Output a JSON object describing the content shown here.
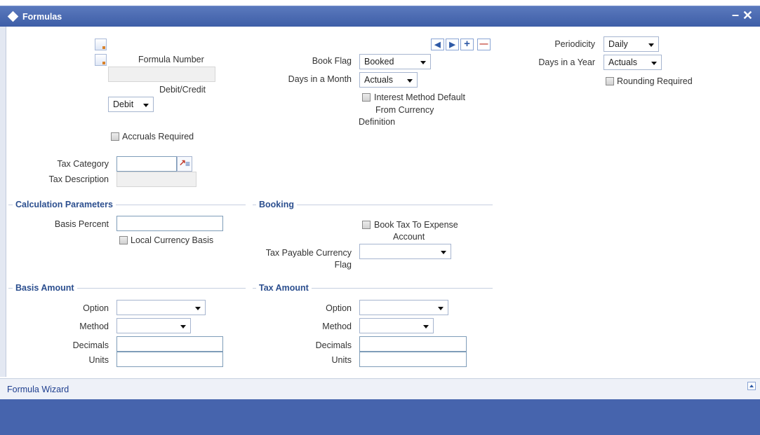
{
  "window": {
    "title": "Formulas",
    "minimize": "–",
    "close": "✕"
  },
  "toolbar": {
    "prev": "◀",
    "next": "▶",
    "add": "+",
    "delete": "—"
  },
  "main": {
    "formula_number_label": "Formula Number",
    "formula_number_value": "",
    "debit_credit_label": "Debit/Credit",
    "debit_credit_value": "Debit",
    "accruals_required_label": "Accruals Required",
    "tax_category_label": "Tax Category",
    "tax_category_value": "",
    "tax_description_label": "Tax Description",
    "tax_description_value": "",
    "book_flag_label": "Book Flag",
    "book_flag_value": "Booked",
    "days_in_month_label": "Days in a Month",
    "days_in_month_value": "Actuals",
    "interest_method_line1": "Interest Method Default",
    "interest_method_line2": "From Currency",
    "interest_method_line3": "Definition",
    "periodicity_label": "Periodicity",
    "periodicity_value": "Daily",
    "days_in_year_label": "Days in a Year",
    "days_in_year_value": "Actuals",
    "rounding_required_label": "Rounding Required"
  },
  "calculation": {
    "header": "Calculation Parameters",
    "basis_percent_label": "Basis Percent",
    "basis_percent_value": "",
    "local_currency_basis_label": "Local Currency Basis"
  },
  "booking": {
    "header": "Booking",
    "book_tax_line1": "Book Tax To Expense",
    "book_tax_line2": "Account",
    "tax_payable_line1": "Tax Payable Currency",
    "tax_payable_line2": "Flag",
    "tax_payable_value": ""
  },
  "basis_amount": {
    "header": "Basis Amount",
    "option_label": "Option",
    "option_value": "",
    "method_label": "Method",
    "method_value": "",
    "decimals_label": "Decimals",
    "decimals_value": "",
    "units_label": "Units",
    "units_value": ""
  },
  "tax_amount": {
    "header": "Tax Amount",
    "option_label": "Option",
    "option_value": "",
    "method_label": "Method",
    "method_value": "",
    "decimals_label": "Decimals",
    "decimals_value": "",
    "units_label": "Units",
    "units_value": ""
  },
  "footer": {
    "link": "Formula Wizard"
  },
  "colors": {
    "titlebar": "#4666ad",
    "section_header": "#2c4f8f",
    "bottom_band": "#4664ad"
  }
}
